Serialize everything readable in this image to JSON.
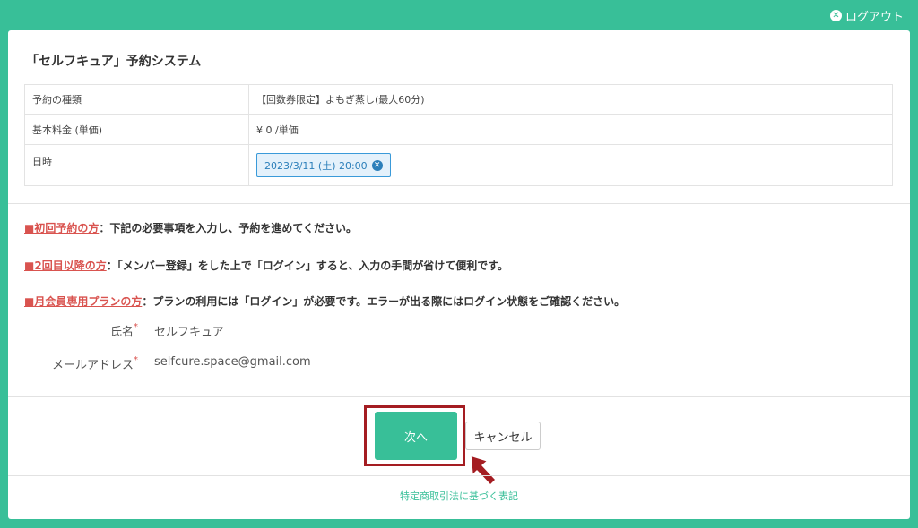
{
  "header": {
    "logout_label": "ログアウト"
  },
  "panel": {
    "title": "「セルフキュア」予約システム",
    "info": {
      "type_label": "予約の種類",
      "type_value": "【回数券限定】よもぎ蒸し(最大60分)",
      "price_label": "基本料金 (単価)",
      "price_value": "¥ 0 /単価",
      "datetime_label": "日時",
      "datetime_value": "2023/3/11 (土) 20:00"
    },
    "notes": [
      {
        "tag": "■初回予約の方",
        "text": "：下記の必要事項を入力し、予約を進めてください。"
      },
      {
        "tag": "■2回目以降の方",
        "text": "：「メンバー登録」をした上で「ログイン」すると、入力の手間が省けて便利です。"
      },
      {
        "tag": "■月会員専用プランの方",
        "text": "：プランの利用には「ログイン」が必要です。エラーが出る際にはログイン状態をご確認ください。"
      }
    ],
    "form": {
      "name_label": "氏名",
      "name_value": "セルフキュア",
      "email_label": "メールアドレス",
      "email_value": "selfcure.space@gmail.com",
      "required_mark": "*"
    },
    "buttons": {
      "next_label": "次へ",
      "cancel_label": "キャンセル"
    },
    "footer_link": "特定商取引法に基づく表記"
  },
  "colors": {
    "accent": "#38bf98",
    "highlight": "#a41d22",
    "required": "#d9534f"
  }
}
